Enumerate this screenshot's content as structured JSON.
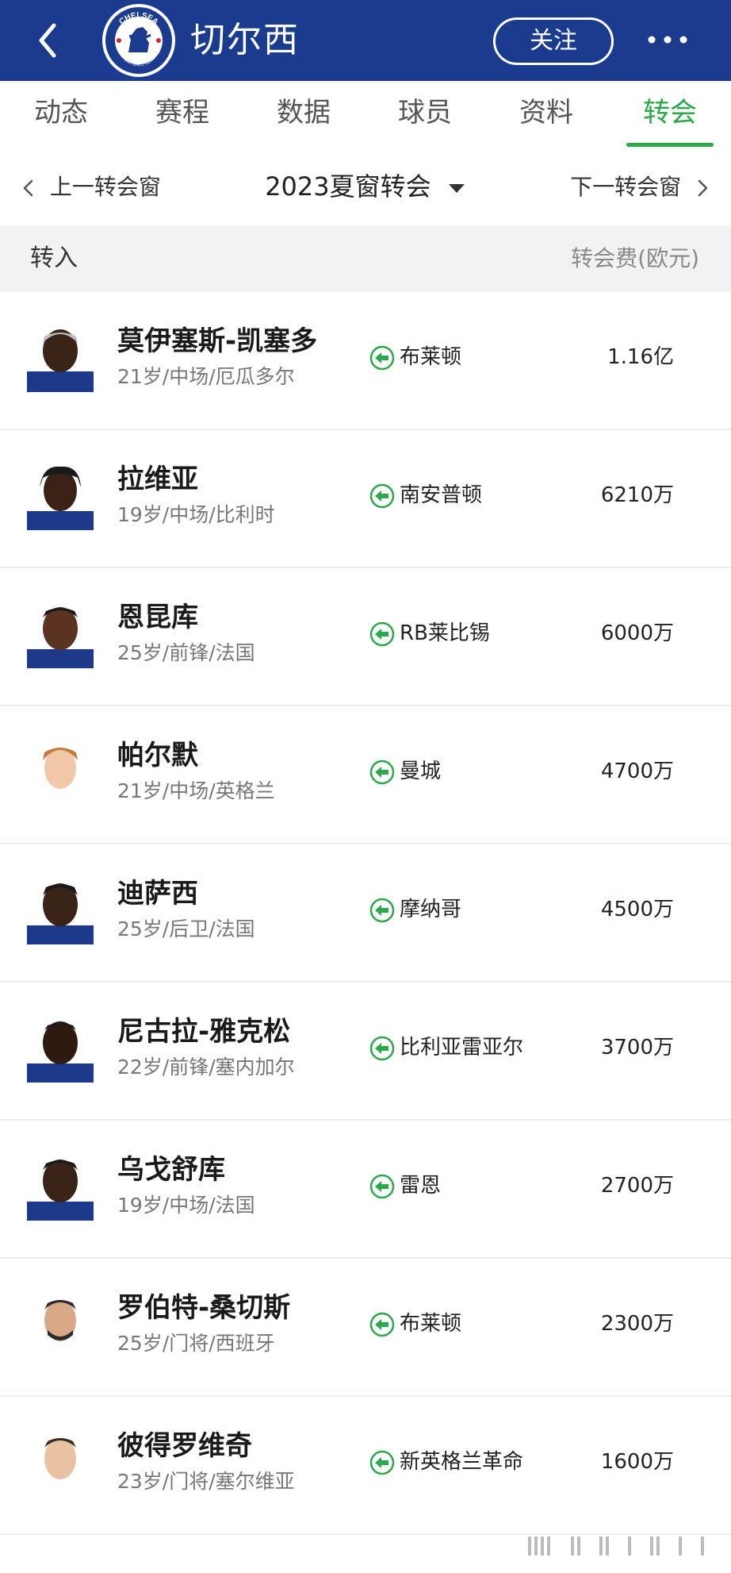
{
  "header": {
    "title": "切尔西",
    "follow_label": "关注",
    "logo_text": "CHELSEA FOOTBALL CLUB",
    "bg_color": "#1a3b8e"
  },
  "tabs": [
    {
      "label": "动态",
      "active": false
    },
    {
      "label": "赛程",
      "active": false
    },
    {
      "label": "数据",
      "active": false
    },
    {
      "label": "球员",
      "active": false
    },
    {
      "label": "资料",
      "active": false
    },
    {
      "label": "转会",
      "active": true
    }
  ],
  "window_nav": {
    "prev_label": "上一转会窗",
    "current_label": "2023夏窗转会",
    "next_label": "下一转会窗"
  },
  "section": {
    "left_label": "转入",
    "right_label": "转会费(欧元)"
  },
  "accent_color": "#2aa84a",
  "transfers": [
    {
      "name": "莫伊塞斯-凯塞多",
      "meta": "21岁/中场/厄瓜多尔",
      "from_club": "布莱顿",
      "fee": "1.16亿"
    },
    {
      "name": "拉维亚",
      "meta": "19岁/中场/比利时",
      "from_club": "南安普顿",
      "fee": "6210万"
    },
    {
      "name": "恩昆库",
      "meta": "25岁/前锋/法国",
      "from_club": "RB莱比锡",
      "fee": "6000万"
    },
    {
      "name": "帕尔默",
      "meta": "21岁/中场/英格兰",
      "from_club": "曼城",
      "fee": "4700万"
    },
    {
      "name": "迪萨西",
      "meta": "25岁/后卫/法国",
      "from_club": "摩纳哥",
      "fee": "4500万"
    },
    {
      "name": "尼古拉-雅克松",
      "meta": "22岁/前锋/塞内加尔",
      "from_club": "比利亚雷亚尔",
      "fee": "3700万"
    },
    {
      "name": "乌戈舒库",
      "meta": "19岁/中场/法国",
      "from_club": "雷恩",
      "fee": "2700万"
    },
    {
      "name": "罗伯特-桑切斯",
      "meta": "25岁/门将/西班牙",
      "from_club": "布莱顿",
      "fee": "2300万"
    },
    {
      "name": "彼得罗维奇",
      "meta": "23岁/门将/塞尔维亚",
      "from_club": "新英格兰革命",
      "fee": "1600万"
    }
  ]
}
